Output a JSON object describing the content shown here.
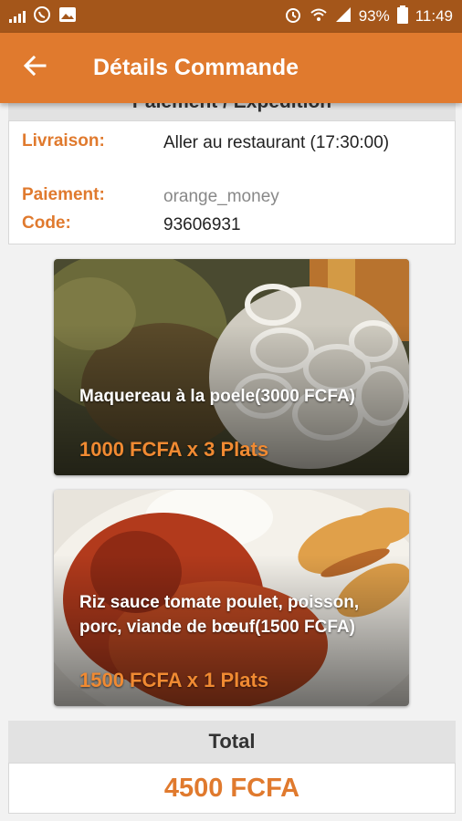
{
  "status_bar": {
    "battery": "93%",
    "time": "11:49",
    "icons": [
      "signal-meter-icon",
      "whatsapp-icon",
      "image-icon",
      "alarm-icon",
      "wifi-icon",
      "cell-signal-icon",
      "battery-icon"
    ]
  },
  "app_bar": {
    "back_icon": "arrow-left-icon",
    "title": "Détails Commande"
  },
  "section": {
    "title": "Paiement / Expédition"
  },
  "details": {
    "delivery_label": "Livraison:",
    "delivery_value": "Aller au restaurant (17:30:00)",
    "payment_label": "Paiement:",
    "payment_value": "orange_money",
    "code_label": "Code:",
    "code_value": "93606931"
  },
  "dishes": [
    {
      "name": "Maquereau à la poele(3000 FCFA)",
      "price_line": "1000 FCFA x 3 Plats"
    },
    {
      "name": "Riz sauce  tomate  poulet, poisson, porc, viande de bœuf(1500 FCFA)",
      "price_line": "1500 FCFA x 1 Plats"
    }
  ],
  "total": {
    "label": "Total",
    "value": "4500 FCFA"
  },
  "colors": {
    "primary": "#e07a2e",
    "status_bar": "#a4561a"
  }
}
